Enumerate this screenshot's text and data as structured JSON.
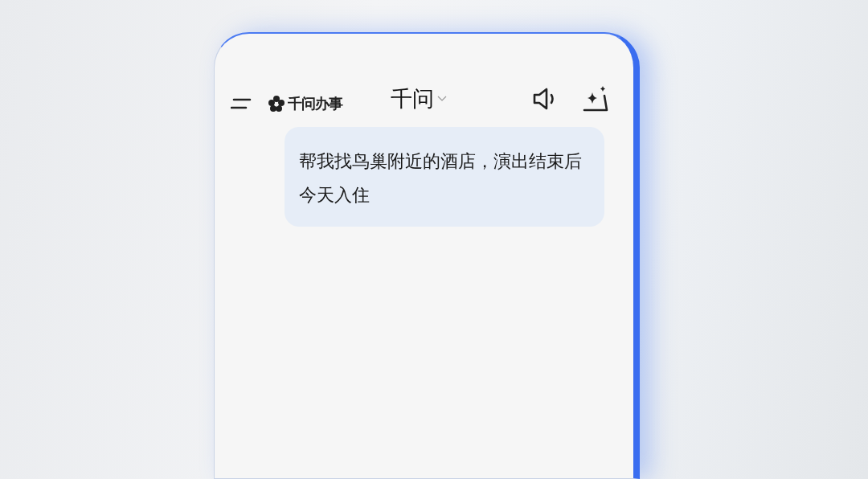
{
  "header": {
    "brand": "千问办事",
    "title": "千问"
  },
  "messages": [
    {
      "text": "帮我找鸟巢附近的酒店，演出结束后今天入住"
    }
  ]
}
